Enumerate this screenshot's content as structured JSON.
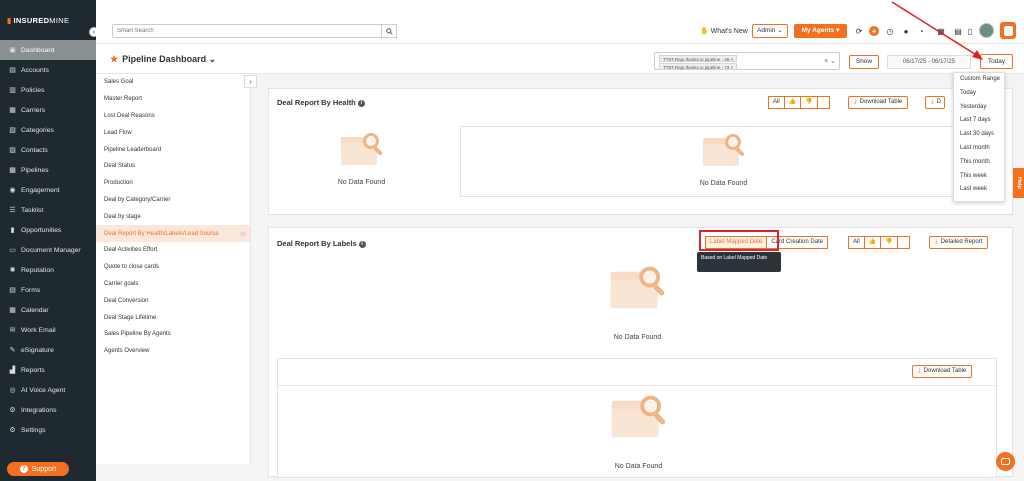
{
  "app": {
    "logo_text": "INSURED",
    "logo_text_light": "MINE",
    "accent_color": "#f37021"
  },
  "sidebar": {
    "items": [
      {
        "label": "Dashboard",
        "icon": "dashboard-icon",
        "active": true
      },
      {
        "label": "Accounts",
        "icon": "accounts-icon"
      },
      {
        "label": "Policies",
        "icon": "policies-icon"
      },
      {
        "label": "Carriers",
        "icon": "carriers-icon"
      },
      {
        "label": "Categories",
        "icon": "categories-icon"
      },
      {
        "label": "Contacts",
        "icon": "contacts-icon"
      },
      {
        "label": "Pipelines",
        "icon": "pipelines-icon"
      },
      {
        "label": "Engagement",
        "icon": "engagement-icon"
      },
      {
        "label": "Tasklist",
        "icon": "tasklist-icon"
      },
      {
        "label": "Opportunities",
        "icon": "opportunities-icon"
      },
      {
        "label": "Document Manager",
        "icon": "document-icon"
      },
      {
        "label": "Reputation",
        "icon": "reputation-icon"
      },
      {
        "label": "Forms",
        "icon": "forms-icon"
      },
      {
        "label": "Calendar",
        "icon": "calendar-icon"
      },
      {
        "label": "Work Email",
        "icon": "email-icon"
      },
      {
        "label": "eSignature",
        "icon": "signature-icon"
      },
      {
        "label": "Reports",
        "icon": "reports-icon"
      },
      {
        "label": "AI Voice Agent",
        "icon": "voice-agent-icon"
      },
      {
        "label": "Integrations",
        "icon": "integrations-icon"
      },
      {
        "label": "Settings",
        "icon": "settings-icon"
      }
    ],
    "support_label": "Support"
  },
  "topbar": {
    "search_placeholder": "Smart Search",
    "whats_new": "What's New",
    "admin": "Admin",
    "my_agents": "My Agents"
  },
  "header": {
    "title": "Pipeline Dashboard",
    "pipeline_chips": [
      "TT87-Raju thanks.io pipeline - 46",
      "TT87-Raju thanks.io pipeline - 73"
    ],
    "show_label": "Show",
    "date_range": "06/17/25 - 06/17/25",
    "today_label": "Today"
  },
  "reports": {
    "items": [
      "Sales Goal",
      "Master Report",
      "Lost Deal Reasons",
      "Lead Flow",
      "Pipeline Leaderboard",
      "Deal Status",
      "Production",
      "Deal by Category/Carrier",
      "Deal by stage",
      "Deal Report By Health/Labels/Lead Source",
      "Deal Activities Effort",
      "Quote to close cards",
      "Carrier goals",
      "Deal Conversion",
      "Deal Stage Lifetime",
      "Sales Pipeline By Agents",
      "Agents Overview"
    ],
    "active_index": 9
  },
  "panel_health": {
    "title": "Deal Report By Health",
    "filters": [
      "All"
    ],
    "download_table": "Download Table",
    "detailed_report_cut": "D",
    "no_data": "No Data Found",
    "no_data_inner": "No Data Found"
  },
  "panel_labels": {
    "title": "Deal Report By Labels",
    "label_mapped_date": "Label Mapped Date",
    "card_creation_date": "Card Creation Date",
    "filters": [
      "All"
    ],
    "detailed_report": "Detailed Report",
    "tooltip": "Based on Label Mapped Date",
    "no_data": "No Data Found",
    "download_table": "Download Table",
    "no_data_inner": "No Data Found"
  },
  "date_dropdown": {
    "options": [
      "Custom Range",
      "Today",
      "Yesterday",
      "Last 7 days",
      "Last 30 days",
      "Last month",
      "This month",
      "This week",
      "Last week"
    ]
  },
  "help_tab": "Help"
}
